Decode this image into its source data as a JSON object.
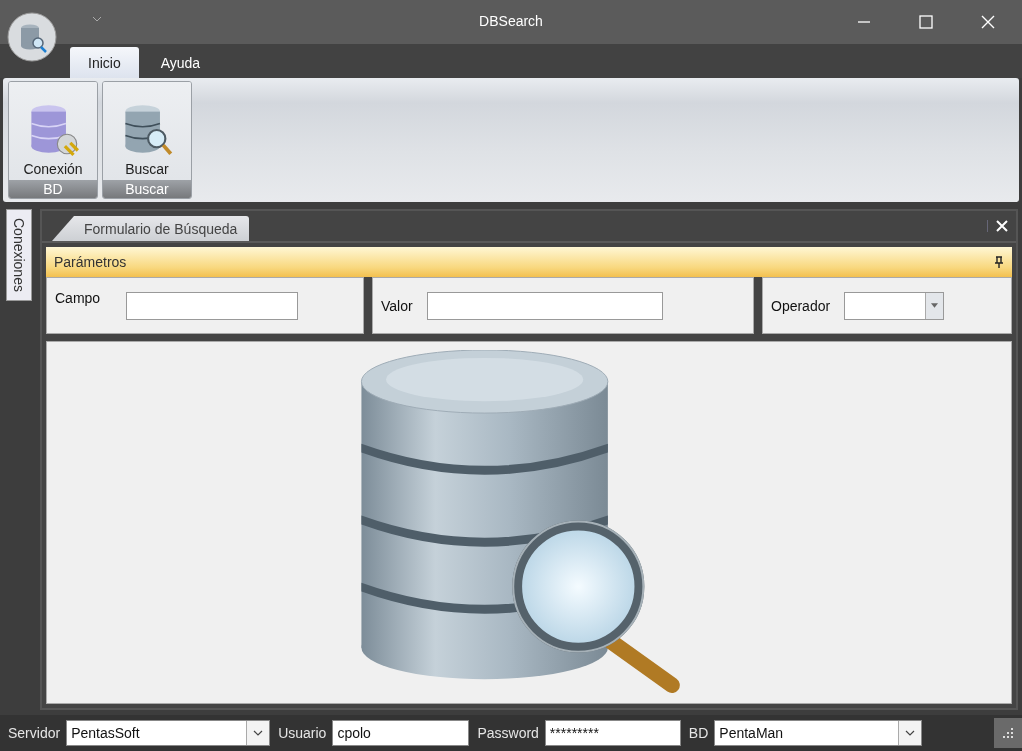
{
  "window": {
    "title": "DBSearch"
  },
  "ribbon_tabs": [
    {
      "label": "Inicio",
      "selected": true
    },
    {
      "label": "Ayuda",
      "selected": false
    }
  ],
  "ribbon_groups": [
    {
      "label": "BD",
      "button": "Conexión",
      "kind": "connect"
    },
    {
      "label": "Buscar",
      "button": "Buscar",
      "kind": "search"
    }
  ],
  "side_tabs": [
    {
      "label": "Conexiones"
    }
  ],
  "document_tabs": [
    {
      "label": "Formulario de Búsqueda",
      "selected": true
    }
  ],
  "parameters_panel": {
    "title": "Parámetros",
    "fields": [
      {
        "label": "Campo",
        "kind": "text"
      },
      {
        "label": "Valor",
        "kind": "text"
      },
      {
        "label": "Operador",
        "kind": "dropdown"
      }
    ]
  },
  "status_bar": [
    {
      "label": "Servidor",
      "value": "PentasSoft",
      "kind": "dropdown"
    },
    {
      "label": "Usuario",
      "value": "cpolo",
      "kind": "text"
    },
    {
      "label": "Password",
      "value": "*********",
      "kind": "text"
    },
    {
      "label": "BD",
      "value": "PentaMan",
      "kind": "dropdown"
    }
  ]
}
